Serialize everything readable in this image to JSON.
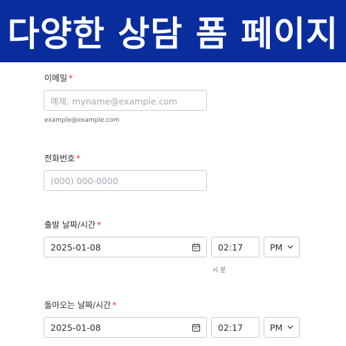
{
  "banner": {
    "title": "다양한 상담 폼 페이지"
  },
  "email": {
    "label": "이메일",
    "required_mark": "*",
    "placeholder": "예제: myname@example.com",
    "sublabel": "example@example.com"
  },
  "phone": {
    "label": "전화번호",
    "required_mark": "*",
    "placeholder": "(000) 000-0000"
  },
  "departure": {
    "label": "출발 날짜/시간",
    "required_mark": "*",
    "date": "2025-01-08",
    "time": "02:17",
    "ampm": "PM",
    "time_sublabel": "시 분"
  },
  "return": {
    "label": "돌아오는 날짜/시간",
    "required_mark": "*",
    "date": "2025-01-08",
    "time": "02:17",
    "ampm": "PM"
  },
  "colors": {
    "banner": "#0a2d9e",
    "required": "#e0312e",
    "border": "#c8ccd3"
  },
  "icons": [
    "calendar-icon",
    "chevron-down-icon"
  ]
}
